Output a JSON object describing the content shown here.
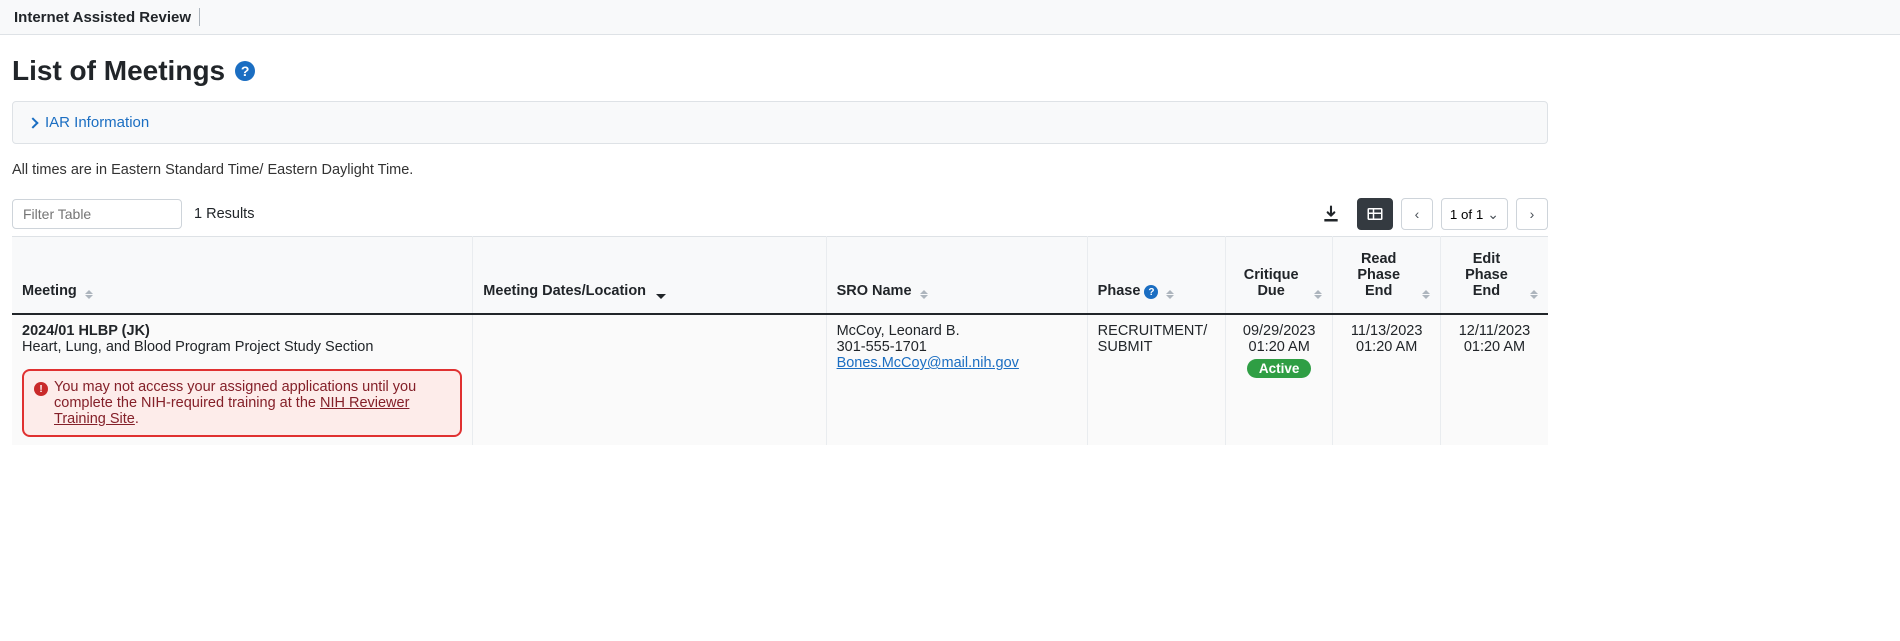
{
  "topbar": {
    "title": "Internet Assisted Review"
  },
  "page": {
    "heading": "List of Meetings",
    "info_panel_label": "IAR Information",
    "tz_note": "All times are in Eastern Standard Time/ Eastern Daylight Time.",
    "filter_placeholder": "Filter Table",
    "results_count": "1 Results",
    "pagination_label": "1 of 1"
  },
  "columns": {
    "meeting": "Meeting",
    "dates_loc": "Meeting Dates/Location",
    "sro": "SRO Name",
    "phase": "Phase",
    "critique_due": "Critique Due",
    "read_end": "Read Phase End",
    "edit_end": "Edit Phase End"
  },
  "row": {
    "meeting_code": "2024/01 HLBP (JK)",
    "meeting_name": "Heart, Lung, and Blood Program Project Study Section",
    "warning_text_1": "You may not access your assigned applications until you complete the NIH-required training at the ",
    "warning_link_text": "NIH Reviewer Training Site",
    "warning_text_2": ".",
    "sro_name": "McCoy, Leonard B.",
    "sro_phone": "301-555-1701",
    "sro_email": "Bones.McCoy@mail.nih.gov",
    "phase": "RECRUITMENT/SUBMIT",
    "critique_due_date": "09/29/2023",
    "critique_due_time": "01:20 AM",
    "critique_badge": "Active",
    "read_end_date": "11/13/2023",
    "read_end_time": "01:20 AM",
    "edit_end_date": "12/11/2023",
    "edit_end_time": "01:20 AM"
  }
}
